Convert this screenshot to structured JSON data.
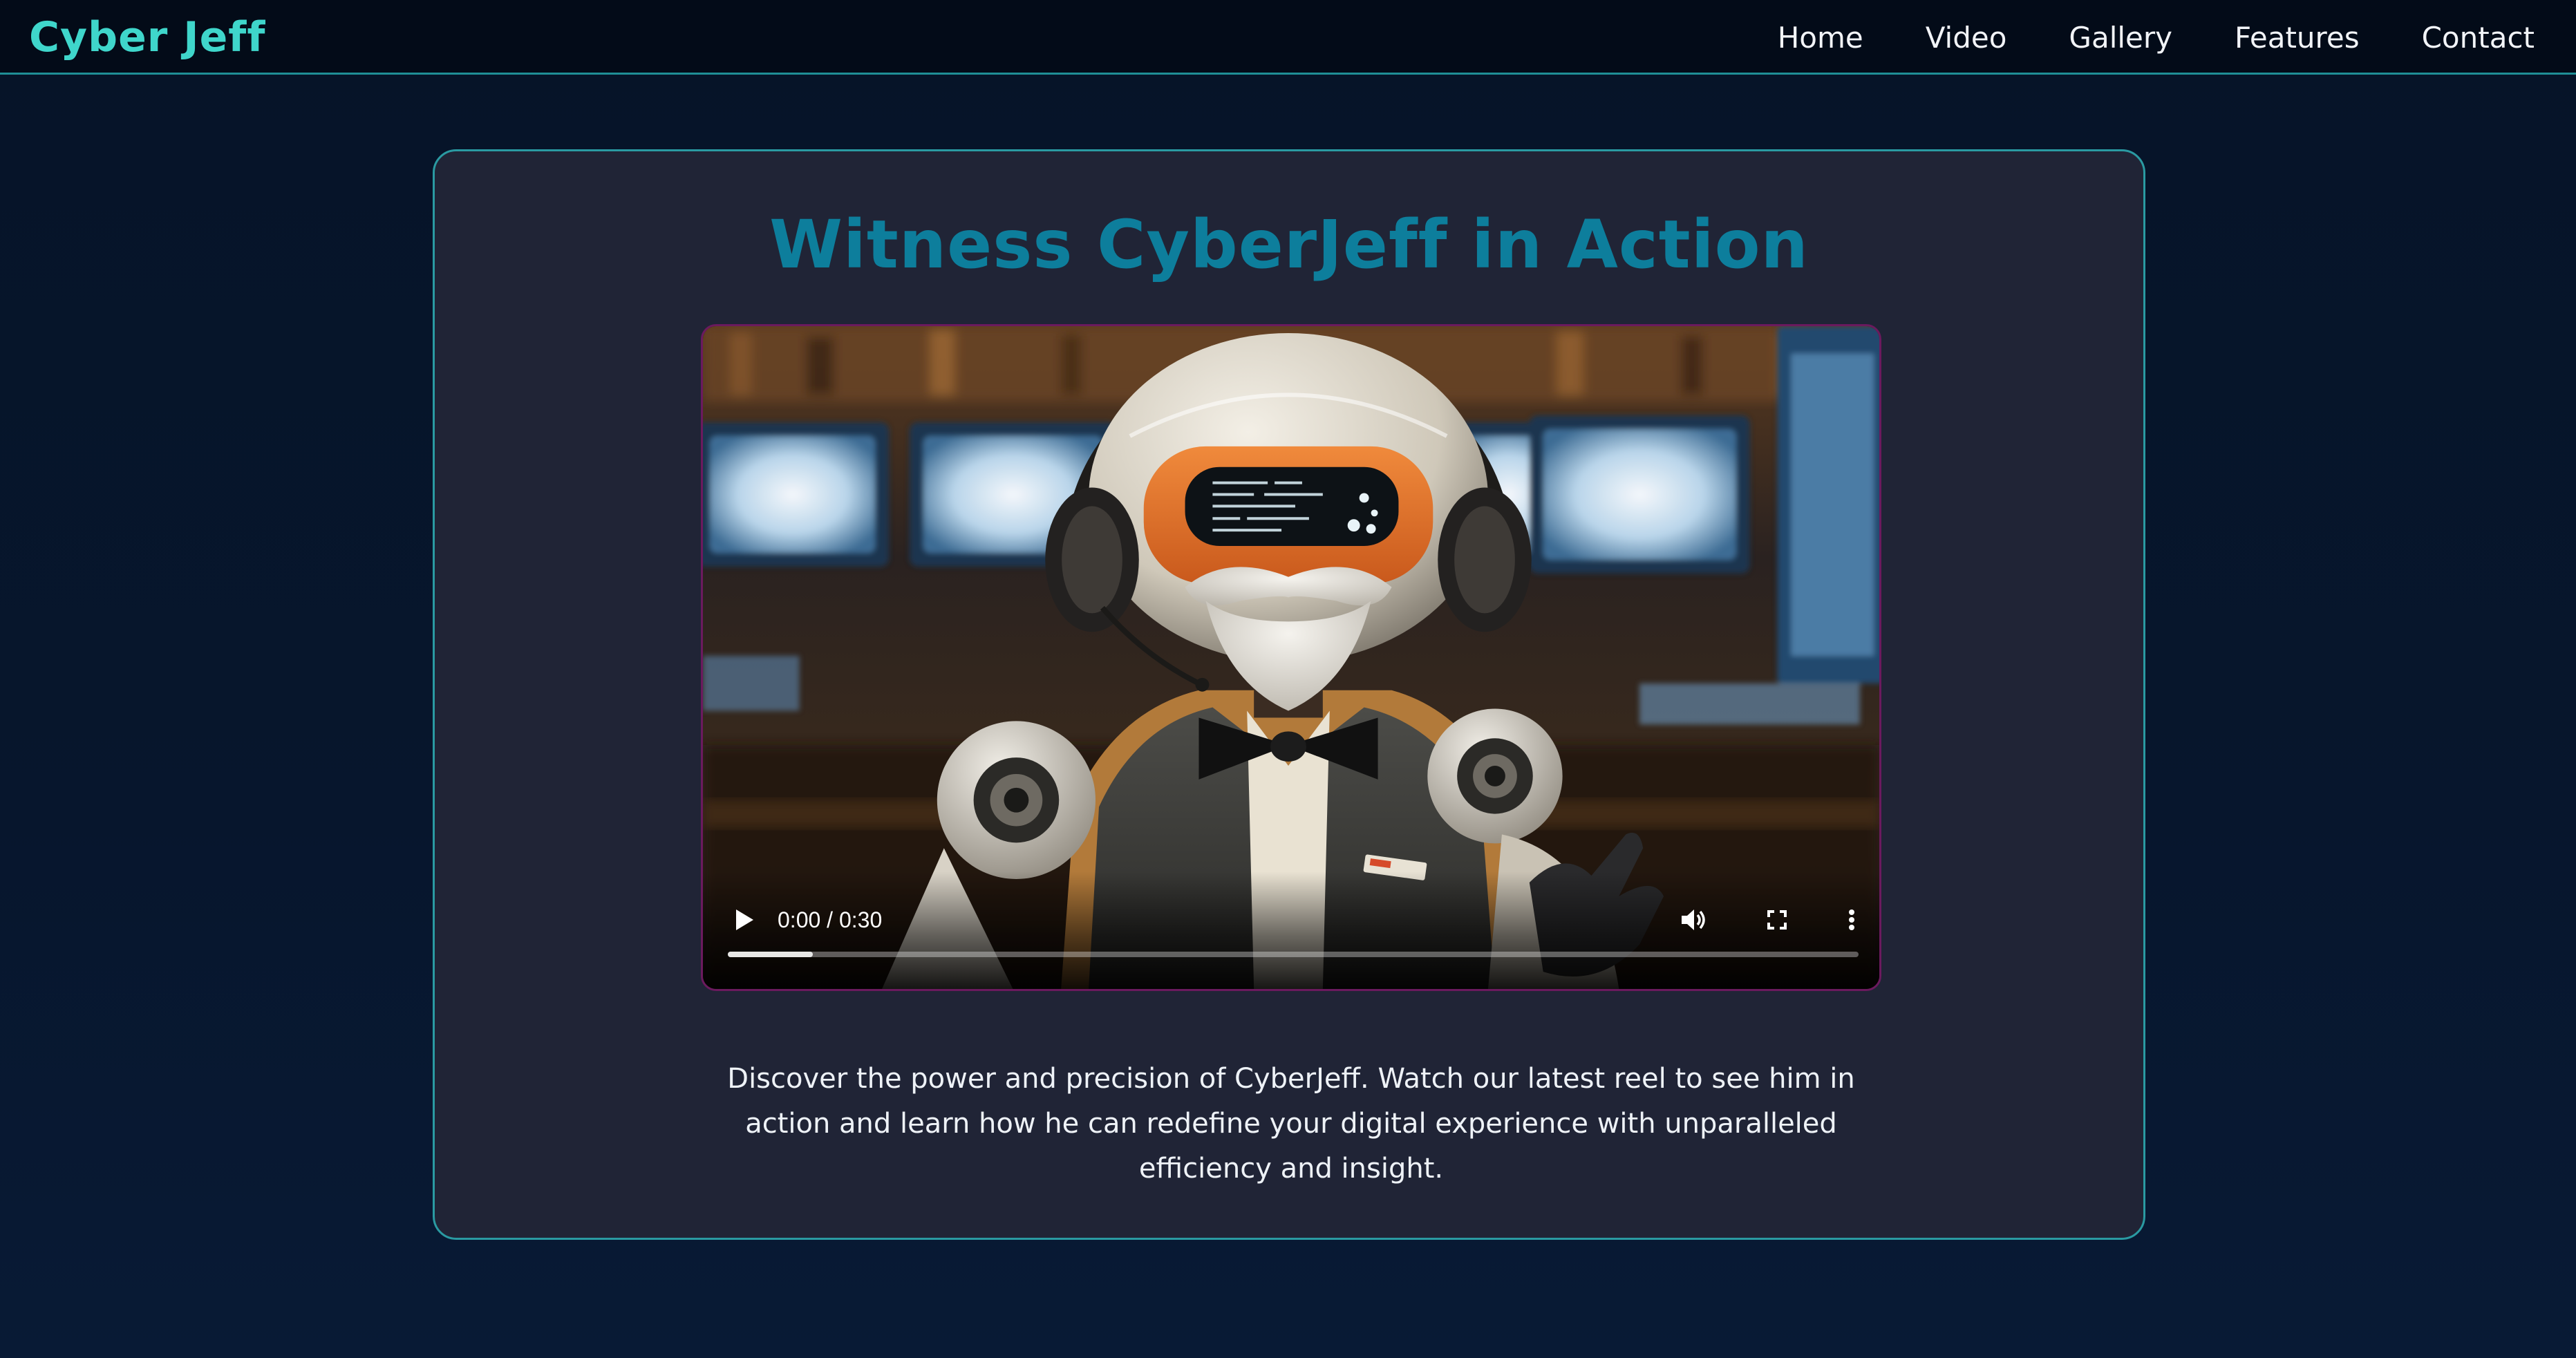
{
  "header": {
    "brand": "Cyber Jeff",
    "nav": [
      {
        "label": "Home"
      },
      {
        "label": "Video"
      },
      {
        "label": "Gallery"
      },
      {
        "label": "Features"
      },
      {
        "label": "Contact"
      }
    ]
  },
  "main": {
    "title": "Witness CyberJeff in Action",
    "video": {
      "time_display": "0:00 / 0:30",
      "buffered_fraction": 0.075,
      "controls": {
        "play_icon": "play-icon",
        "volume_icon": "volume-icon",
        "fullscreen_icon": "fullscreen-icon",
        "more_icon": "more-vertical-icon"
      }
    },
    "description": "Discover the power and precision of CyberJeff. Watch our latest reel to see him in action and learn how he can redefine your digital experience with unparalleled efficiency and insight."
  },
  "colors": {
    "background": "#061428",
    "navbar": "#030b18",
    "brand": "#3fd6cb",
    "accent_border": "#2a9aa2",
    "card": "#202436",
    "title": "#0d7e9c",
    "video_border": "#6b1a5e"
  }
}
